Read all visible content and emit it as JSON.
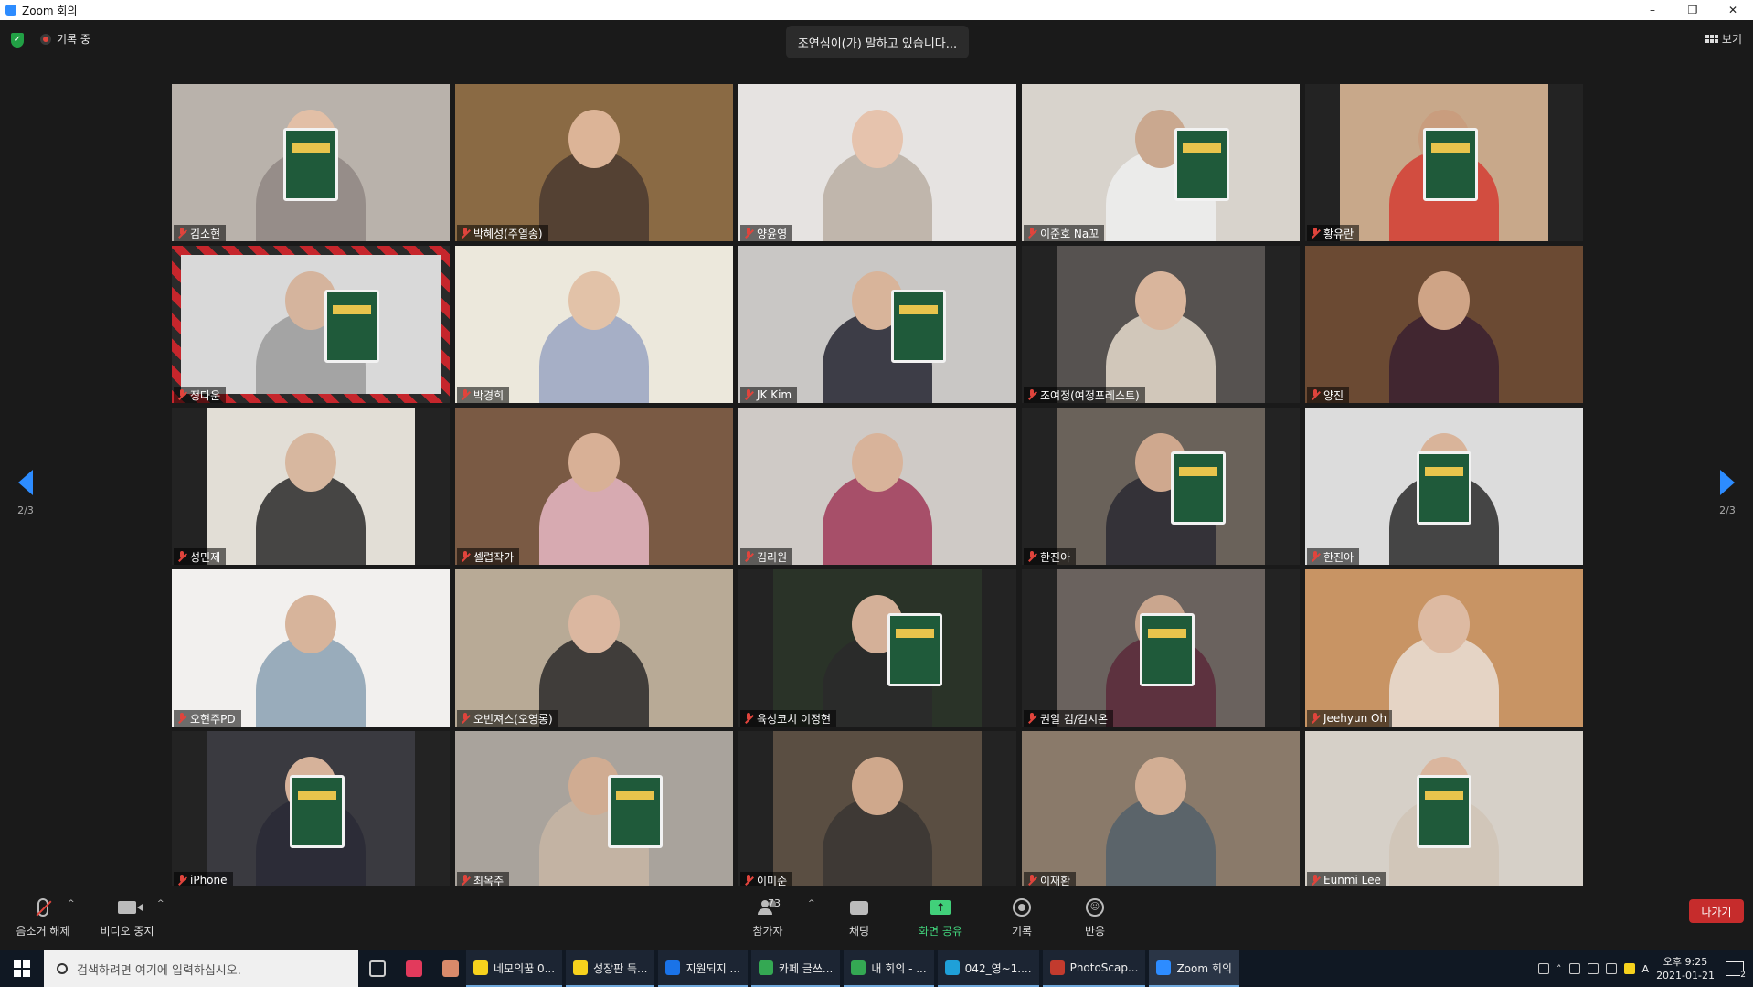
{
  "window": {
    "title": "Zoom 회의",
    "minimize": "–",
    "restore": "❐",
    "close": "✕"
  },
  "meeting": {
    "recording_label": "기록 중",
    "speaking_banner": "조연심이(가) 말하고 있습니다...",
    "view_label": "보기",
    "page_indicator_left": "2/3",
    "page_indicator_right": "2/3"
  },
  "participants": [
    {
      "name": "김소현",
      "bg": "#b9b2ab",
      "skin": "#e2bfa6",
      "shirt": "#8f8682",
      "book": true,
      "narrow": false
    },
    {
      "name": "박혜성(주열송)",
      "bg": "#8a6a44",
      "skin": "#dcb497",
      "shirt": "#4a3a30",
      "book": false,
      "narrow": false
    },
    {
      "name": "양윤영",
      "bg": "#e6e3e1",
      "skin": "#e6c3ad",
      "shirt": "#b8aea2",
      "book": false,
      "narrow": false
    },
    {
      "name": "이준호 Na꼬",
      "bg": "#d8d3cc",
      "skin": "#caa88f",
      "shirt": "#eeeeee",
      "book": true,
      "narrow": false
    },
    {
      "name": "황유란",
      "bg": "#c8a88a",
      "skin": "#c99d7e",
      "shirt": "#d43d32",
      "book": true,
      "narrow": true
    },
    {
      "name": "정다운",
      "bg": "#d9d9d9",
      "skin": "#d5b49d",
      "shirt": "#9a9a9a",
      "book": true,
      "narrow": false,
      "frame": true
    },
    {
      "name": "박경희",
      "bg": "#ece8dc",
      "skin": "#e2c2a8",
      "shirt": "#9aa4c2",
      "book": false,
      "narrow": false
    },
    {
      "name": "JK Kim",
      "bg": "#c9c7c5",
      "skin": "#d8b49a",
      "shirt": "#252530",
      "book": true,
      "narrow": false
    },
    {
      "name": "조여정(여정포레스트)",
      "bg": "#565250",
      "skin": "#d9b59c",
      "shirt": "#e6dccd",
      "book": false,
      "narrow": true
    },
    {
      "name": "양진",
      "bg": "#6b4a33",
      "skin": "#cfa486",
      "shirt": "#3a2030",
      "book": false,
      "narrow": false
    },
    {
      "name": "성민제",
      "bg": "#e2ded6",
      "skin": "#d7b79f",
      "shirt": "#2a2a2a",
      "book": false,
      "narrow": true
    },
    {
      "name": "셀럽작가",
      "bg": "#7a5a44",
      "skin": "#d8b096",
      "shirt": "#e8b8c4",
      "book": false,
      "narrow": false
    },
    {
      "name": "김리원",
      "bg": "#cfcac6",
      "skin": "#d8b39a",
      "shirt": "#a03a58",
      "book": false,
      "narrow": false
    },
    {
      "name": "한진아",
      "bg": "#6a625a",
      "skin": "#cfa88e",
      "shirt": "#2a2a32",
      "book": true,
      "narrow": true
    },
    {
      "name": "한진아",
      "bg": "#dcdcdc",
      "skin": "#d9b49a",
      "shirt": "#2a2a2a",
      "book": true,
      "narrow": false
    },
    {
      "name": "오현주PD",
      "bg": "#f2f0ee",
      "skin": "#d7b49b",
      "shirt": "#8aa0b2",
      "book": false,
      "narrow": false
    },
    {
      "name": "오빈져스(오영롱)",
      "bg": "#b8aa96",
      "skin": "#dbb7a0",
      "shirt": "#2a2a2a",
      "book": false,
      "narrow": false
    },
    {
      "name": "육성코치 이정현",
      "bg": "#2a3328",
      "skin": "#d4b098",
      "shirt": "#2a2a2a",
      "book": true,
      "narrow": true
    },
    {
      "name": "권일 김/김시온",
      "bg": "#6a625e",
      "skin": "#caa68e",
      "shirt": "#5a2a3a",
      "book": true,
      "narrow": true
    },
    {
      "name": "Jeehyun Oh",
      "bg": "#c89464",
      "skin": "#ddbaa2",
      "shirt": "#eadfd6",
      "book": false,
      "narrow": false
    },
    {
      "name": "iPhone",
      "bg": "#3a3a40",
      "skin": "#d6b29a",
      "shirt": "#2a2a36",
      "book": true,
      "narrow": true
    },
    {
      "name": "최옥주",
      "bg": "#a9a39c",
      "skin": "#d0ac92",
      "shirt": "#c8b6a4",
      "book": true,
      "narrow": false
    },
    {
      "name": "이미순",
      "bg": "#5a4e42",
      "skin": "#cfa88c",
      "shirt": "#3a3632",
      "book": false,
      "narrow": true
    },
    {
      "name": "이재환",
      "bg": "#8a7a6a",
      "skin": "#d2ae94",
      "shirt": "#52606a",
      "book": false,
      "narrow": false
    },
    {
      "name": "Eunmi Lee",
      "bg": "#d6d0c8",
      "skin": "#dab69e",
      "shirt": "#d0c4b6",
      "book": true,
      "narrow": false
    }
  ],
  "toolbar": {
    "mute_label": "음소거 해제",
    "video_label": "비디오 중지",
    "participants_label": "참가자",
    "participants_count": "73",
    "chat_label": "채팅",
    "share_label": "화면 공유",
    "record_label": "기록",
    "reactions_label": "반응",
    "leave_label": "나가기",
    "caret": "^"
  },
  "taskbar": {
    "search_placeholder": "검색하려면 여기에 입력하십시오.",
    "apps": [
      {
        "label": "네모의꿈 0...",
        "color": "#f7d21d"
      },
      {
        "label": "성장판 독...",
        "color": "#f7d21d"
      },
      {
        "label": "지원되지 ...",
        "color": "#1a73e8"
      },
      {
        "label": "카페 글쓰...",
        "color": "#34a853"
      },
      {
        "label": "내 회의 - ...",
        "color": "#34a853"
      },
      {
        "label": "042_영~1....",
        "color": "#1fa0d8"
      },
      {
        "label": "PhotoScap...",
        "color": "#c23b2e"
      },
      {
        "label": "Zoom 회의",
        "color": "#2d8cff"
      }
    ],
    "clock_time": "오후 9:25",
    "clock_date": "2021-01-21",
    "ime": "A",
    "notif_count": "2",
    "colors": {
      "accent": "#2d8cff",
      "danger": "#c62c2c",
      "share": "#41d07a"
    }
  }
}
